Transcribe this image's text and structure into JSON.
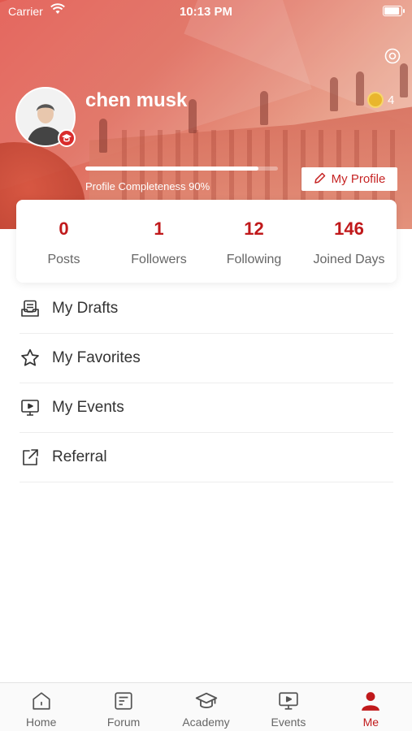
{
  "status_bar": {
    "carrier": "Carrier",
    "time": "10:13 PM"
  },
  "profile": {
    "name": "chen musk",
    "coins": "4",
    "completeness_label": "Profile Completeness 90%",
    "completeness_value": 0.9,
    "my_profile_button": "My Profile"
  },
  "stats": [
    {
      "value": "0",
      "label": "Posts"
    },
    {
      "value": "1",
      "label": "Followers"
    },
    {
      "value": "12",
      "label": "Following"
    },
    {
      "value": "146",
      "label": "Joined Days"
    }
  ],
  "menu": [
    {
      "label": "My Drafts",
      "icon": "drafts-icon"
    },
    {
      "label": "My Favorites",
      "icon": "star-icon"
    },
    {
      "label": "My Events",
      "icon": "events-icon"
    },
    {
      "label": "Referral",
      "icon": "share-icon"
    }
  ],
  "tabs": [
    {
      "label": "Home",
      "icon": "home-icon",
      "active": false
    },
    {
      "label": "Forum",
      "icon": "forum-icon",
      "active": false
    },
    {
      "label": "Academy",
      "icon": "academy-icon",
      "active": false
    },
    {
      "label": "Events",
      "icon": "events-icon",
      "active": false
    },
    {
      "label": "Me",
      "icon": "user-icon",
      "active": true
    }
  ],
  "colors": {
    "accent": "#c0191b",
    "header": "#e2574e"
  }
}
